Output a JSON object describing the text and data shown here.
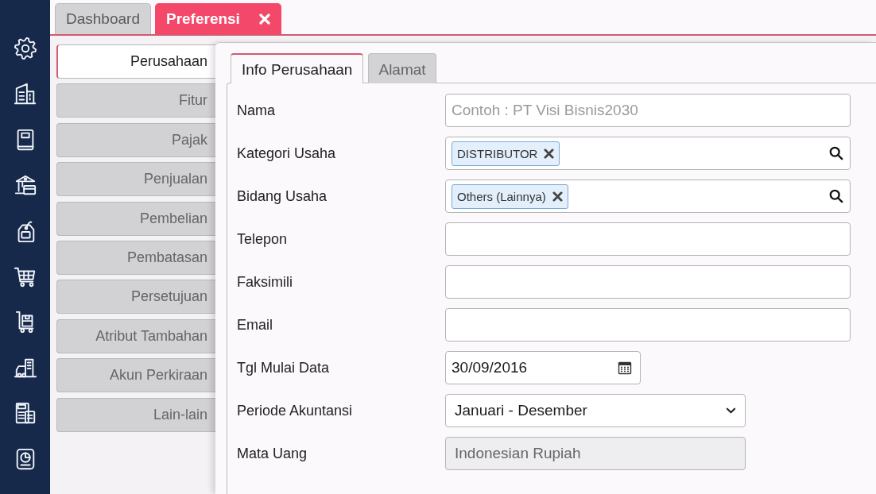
{
  "tabs": [
    {
      "label": "Dashboard",
      "selected": false,
      "closable": false
    },
    {
      "label": "Preferensi",
      "selected": true,
      "closable": true
    }
  ],
  "settings_nav": {
    "items": [
      {
        "label": "Perusahaan",
        "selected": true
      },
      {
        "label": "Fitur",
        "selected": false
      },
      {
        "label": "Pajak",
        "selected": false
      },
      {
        "label": "Penjualan",
        "selected": false
      },
      {
        "label": "Pembelian",
        "selected": false
      },
      {
        "label": "Pembatasan",
        "selected": false
      },
      {
        "label": "Persetujuan",
        "selected": false
      },
      {
        "label": "Atribut Tambahan",
        "selected": false
      },
      {
        "label": "Akun Perkiraan",
        "selected": false
      },
      {
        "label": "Lain-lain",
        "selected": false
      }
    ]
  },
  "section_tabs": [
    {
      "label": "Info Perusahaan",
      "selected": true
    },
    {
      "label": "Alamat",
      "selected": false
    }
  ],
  "form": {
    "fields": [
      {
        "label": "Nama",
        "kind": "text",
        "placeholder": "Contoh : PT Visi Bisnis2030",
        "disabled": false
      },
      {
        "label": "Kategori Usaha",
        "kind": "tags",
        "tags": [
          "DISTRIBUTOR"
        ],
        "disabled": false
      },
      {
        "label": "Bidang Usaha",
        "kind": "tags",
        "tags": [
          "Others (Lainnya)"
        ],
        "disabled": false
      },
      {
        "label": "Telepon",
        "kind": "text",
        "disabled": false
      },
      {
        "label": "Faksimili",
        "kind": "text",
        "disabled": false
      },
      {
        "label": "Email",
        "kind": "text",
        "disabled": false
      },
      {
        "label": "Tgl Mulai Data",
        "kind": "date",
        "value": "30/09/2016",
        "disabled": false
      },
      {
        "label": "Periode Akuntansi",
        "kind": "select",
        "value": "Januari - Desember",
        "disabled": false
      },
      {
        "label": "Mata Uang",
        "kind": "text",
        "value": "Indonesian Rupiah",
        "disabled": true
      }
    ]
  }
}
